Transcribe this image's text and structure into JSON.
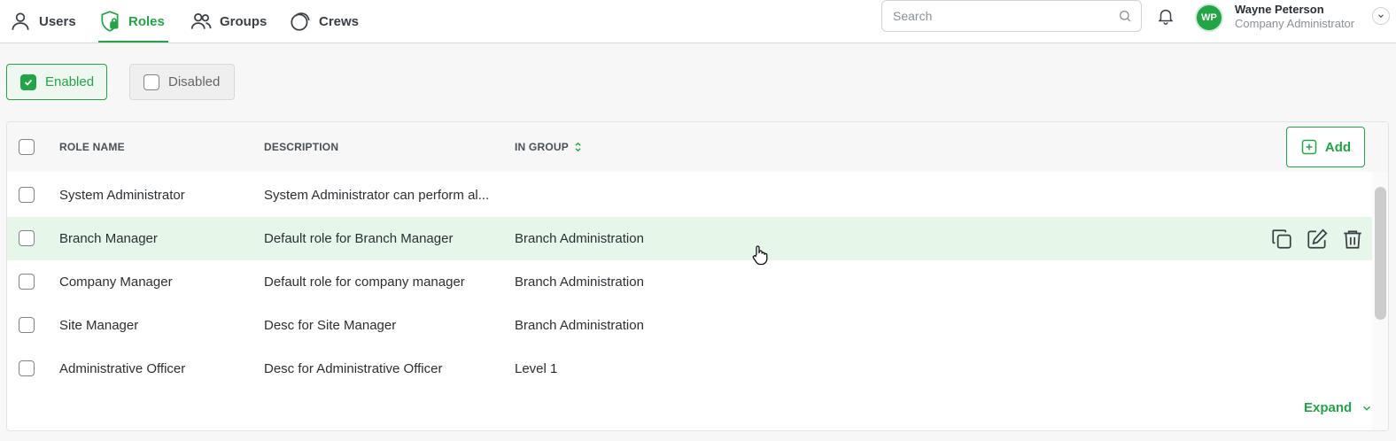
{
  "nav": {
    "tabs": [
      {
        "label": "Users",
        "icon": "user-icon"
      },
      {
        "label": "Roles",
        "icon": "shield-lock-icon",
        "active": true
      },
      {
        "label": "Groups",
        "icon": "users-group-icon"
      },
      {
        "label": "Crews",
        "icon": "crews-icon"
      }
    ]
  },
  "search": {
    "placeholder": "Search",
    "value": ""
  },
  "user": {
    "initials": "WP",
    "name": "Wayne Peterson",
    "role": "Company Administrator"
  },
  "filters": {
    "enabled_label": "Enabled",
    "enabled_checked": true,
    "disabled_label": "Disabled",
    "disabled_checked": false
  },
  "table": {
    "headers": {
      "role_name": "ROLE NAME",
      "description": "DESCRIPTION",
      "in_group": "IN GROUP"
    },
    "add_label": "Add",
    "rows": [
      {
        "name": "System Administrator",
        "description": "System Administrator can perform al...",
        "group": ""
      },
      {
        "name": "Branch Manager",
        "description": "Default role for Branch Manager",
        "group": "Branch Administration"
      },
      {
        "name": "Company Manager",
        "description": "Default role for company manager",
        "group": "Branch Administration"
      },
      {
        "name": "Site Manager",
        "description": "Desc for Site Manager",
        "group": "Branch Administration"
      },
      {
        "name": "Administrative Officer",
        "description": "Desc for Administrative Officer",
        "group": "Level 1"
      }
    ],
    "expand_label": "Expand"
  },
  "colors": {
    "accent": "#22a447",
    "hover_row": "#e6f7ea"
  }
}
